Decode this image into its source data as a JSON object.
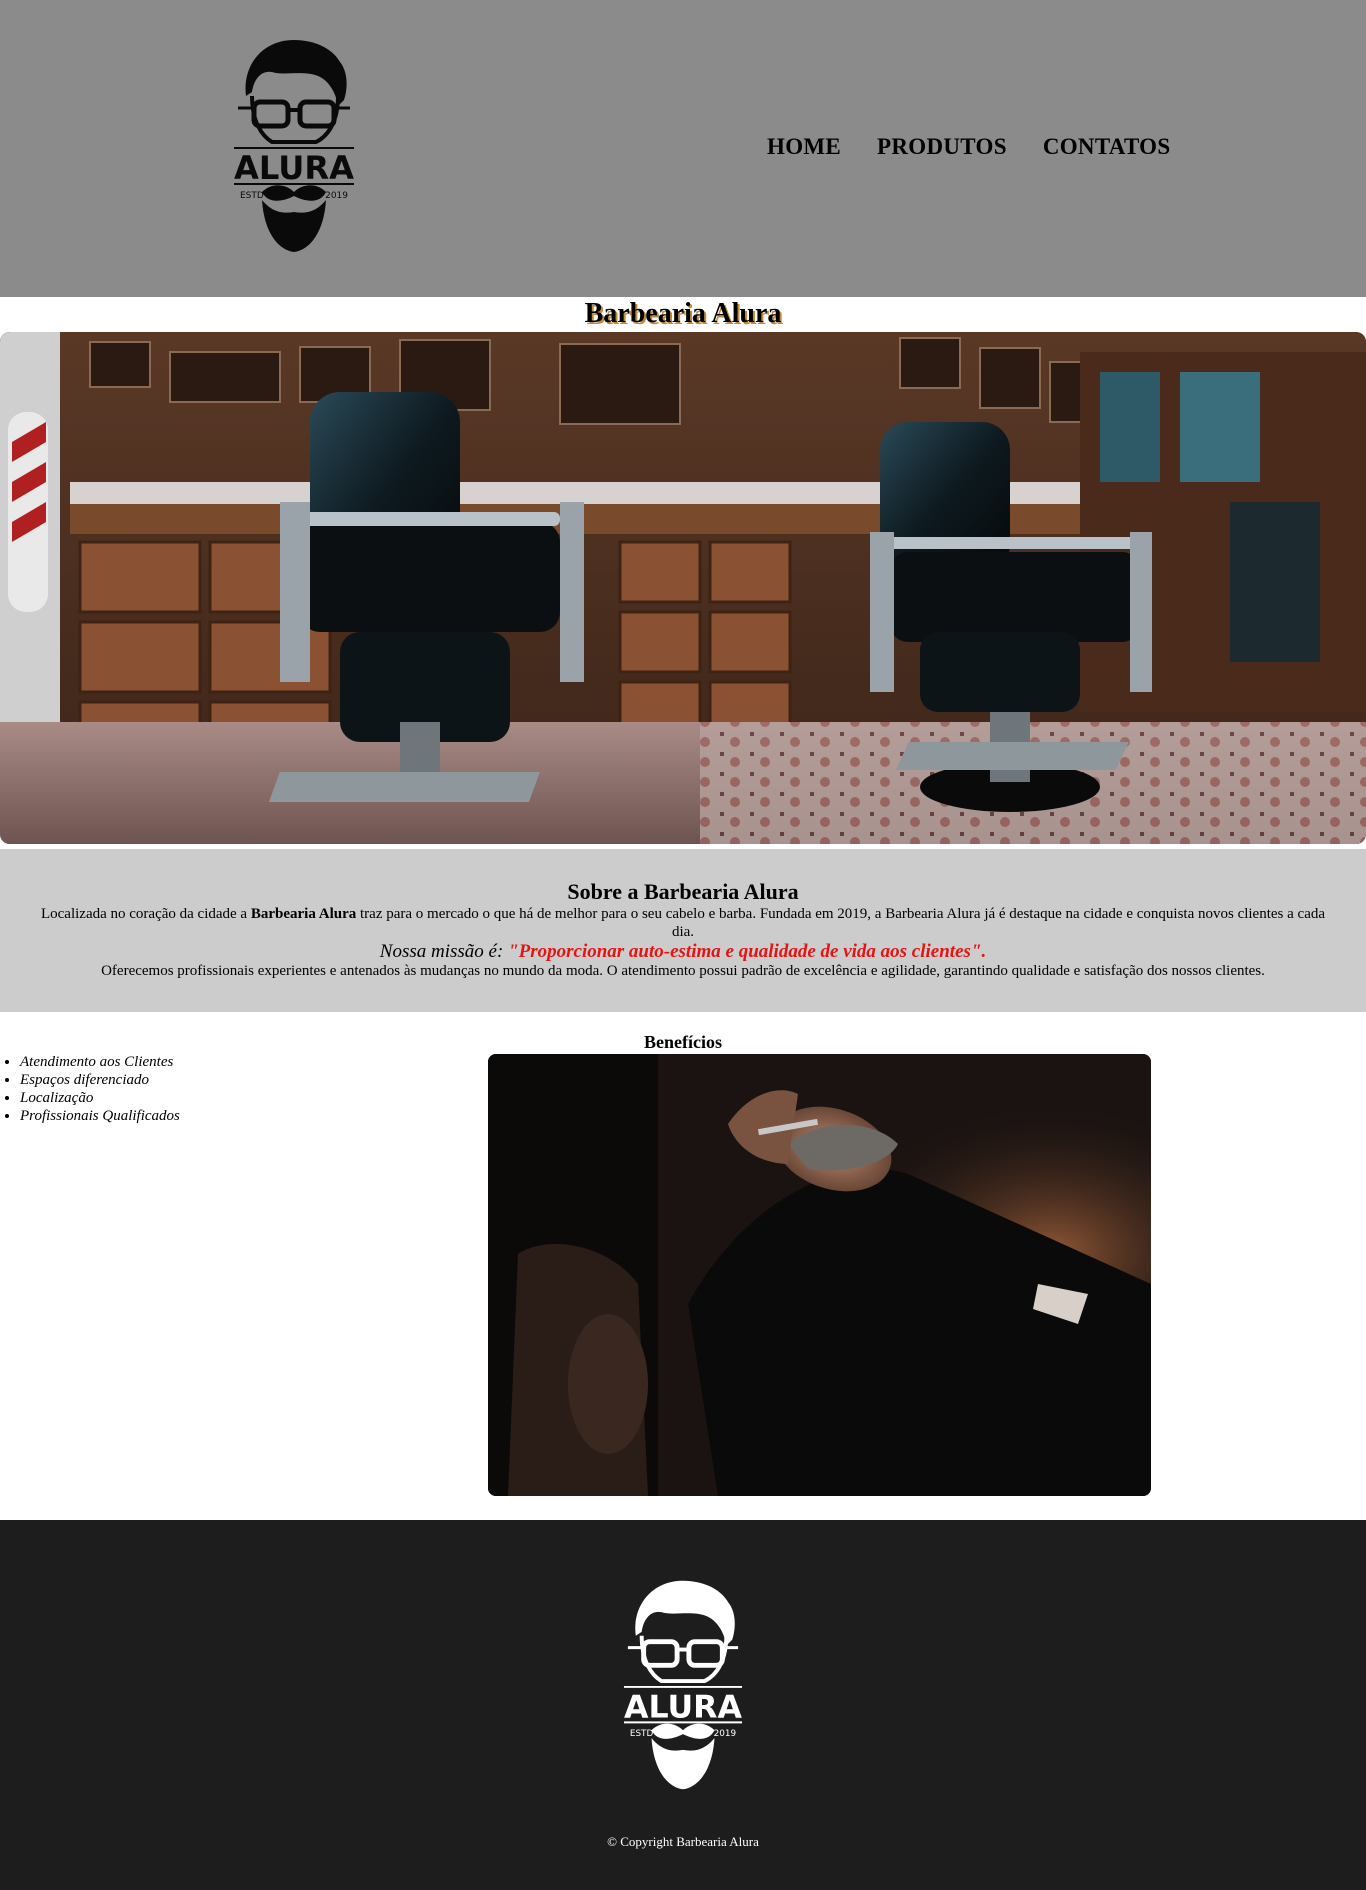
{
  "header": {
    "logo": {
      "icon": "alura-barber-logo-icon",
      "brand": "ALURA",
      "estd": "ESTD",
      "year": "2019"
    },
    "nav": [
      {
        "label": "HOME"
      },
      {
        "label": "PRODUTOS"
      },
      {
        "label": "CONTATOS"
      }
    ]
  },
  "title": "Barbearia Alura",
  "hero": {
    "icon": "barbershop-interior-photo"
  },
  "about": {
    "heading": "Sobre a Barbearia Alura",
    "para1_pre": "Localizada no coração da cidade a ",
    "para1_bold": "Barbearia Alura",
    "para1_post": " traz para o mercado o que há de melhor para o seu cabelo e barba. Fundada em 2019, a Barbearia Alura já é destaque na cidade e conquista novos clientes a cada dia.",
    "mission_label": "Nossa missão é: ",
    "mission_quote": "\"Proporcionar auto-estima e qualidade de vida aos clientes\".",
    "para2": "Oferecemos profissionais experientes e antenados às mudanças no mundo da moda. O atendimento possui padrão de excelência e agilidade, garantindo qualidade e satisfação dos nossos clientes."
  },
  "benefits": {
    "title": "Benefícios",
    "items": [
      "Atendimento aos Clientes",
      "Espaços diferenciado",
      "Localização",
      "Profissionais Qualificados"
    ],
    "image": {
      "icon": "beard-trim-photo"
    }
  },
  "footer": {
    "logo": {
      "icon": "alura-barber-logo-white-icon",
      "brand": "ALURA",
      "estd": "ESTD",
      "year": "2019"
    },
    "copyright": "© Copyright Barbearia Alura"
  },
  "colors": {
    "header_bg": "#8b8b8b",
    "about_bg": "#cccccc",
    "footer_bg": "#1d1d1d",
    "mission_accent": "#e31414",
    "title_shadow": "#c08a3e"
  }
}
